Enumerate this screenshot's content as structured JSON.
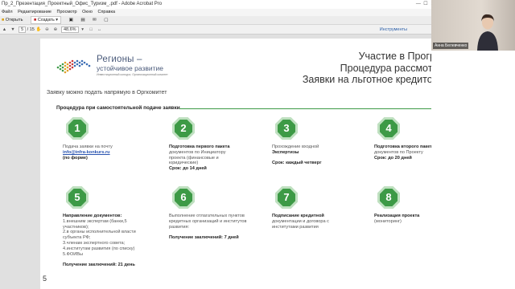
{
  "window": {
    "title": "Пр_2_Презентация_Проектный_Офис_Туризм_.pdf - Adobe Acrobat Pro",
    "controls": [
      "—",
      "☐",
      "✕"
    ]
  },
  "menubar": [
    "Файл",
    "Редактирование",
    "Просмотр",
    "Окно",
    "Справка"
  ],
  "toolbar": {
    "open_label": "Открыть",
    "create_label": "Создать",
    "create_arrow": "▾"
  },
  "navbar": {
    "page_current": "5",
    "page_total": "/ 15",
    "zoom": "48,6%",
    "tools_label": "Инструменты"
  },
  "video": {
    "participant_name": "Анна Белевченко"
  },
  "slide": {
    "logo_title": "Регионы –",
    "logo_subtitle": "устойчивое развитие",
    "logo_caption": "Инвестиционный конкурс; Организационный комитет",
    "headline": [
      "Участие в Программе",
      "Процедура рассмотрения",
      "Заявки на льготное кредитование"
    ],
    "apply_note": "Заявку можно подать напрямую в Оргкомитет",
    "procedure_title": "Процедура при самостоятельной подаче заявки",
    "page_number": "5",
    "steps": [
      {
        "num": "1",
        "lines": [
          {
            "t": "Подача заявки на почту",
            "s": "n"
          },
          {
            "t": "info@infra-konkurs.ru",
            "s": "link"
          },
          {
            "t": "(по форме)",
            "s": "b"
          }
        ]
      },
      {
        "num": "2",
        "lines": [
          {
            "t": "Подготовка первого пакета",
            "s": "b"
          },
          {
            "t": "документов по Инициатору",
            "s": "n"
          },
          {
            "t": "проекта (финансовые и",
            "s": "n"
          },
          {
            "t": "юридические)",
            "s": "n"
          },
          {
            "t": "Срок: до 14 дней",
            "s": "b"
          }
        ]
      },
      {
        "num": "3",
        "lines": [
          {
            "t": "Прохождение входной",
            "s": "mixed1"
          },
          {
            "t": "Экспертизы",
            "s": "b"
          },
          {
            "t": "",
            "s": "n"
          },
          {
            "t": "Срок: каждый четверг",
            "s": "b"
          }
        ]
      },
      {
        "num": "4",
        "lines": [
          {
            "t": "Подготовка второго пакета",
            "s": "b"
          },
          {
            "t": "документов по Проекту",
            "s": "n"
          },
          {
            "t": "Срок: до 20 дней",
            "s": "b"
          }
        ]
      },
      {
        "num": "5",
        "lines": [
          {
            "t": "Направление документов:",
            "s": "b"
          },
          {
            "t": "1.внешним экспертам (банки,5",
            "s": "n"
          },
          {
            "t": "участников);",
            "s": "n"
          },
          {
            "t": "2.в органы исполнительной власти",
            "s": "n"
          },
          {
            "t": "субъекта РФ;",
            "s": "n"
          },
          {
            "t": "3.членам экспертного совета;",
            "s": "n"
          },
          {
            "t": "4.институтам развития (по списку)",
            "s": "n"
          },
          {
            "t": "5.ФОИВы",
            "s": "n"
          },
          {
            "t": "",
            "s": "n"
          },
          {
            "t": "Получение заключений: 21 день",
            "s": "b"
          }
        ]
      },
      {
        "num": "6",
        "lines": [
          {
            "t": "Выполнение отлагательных пунктов",
            "s": "n"
          },
          {
            "t": "кредитных организаций и институтов",
            "s": "n"
          },
          {
            "t": "развития:",
            "s": "n"
          },
          {
            "t": "",
            "s": "n"
          },
          {
            "t": "Получение заключений: 7 дней",
            "s": "b"
          }
        ]
      },
      {
        "num": "7",
        "lines": [
          {
            "t": "Подписание кредитной",
            "s": "b"
          },
          {
            "t": "документации и договора с",
            "s": "mixed2"
          },
          {
            "t": "институтами развития",
            "s": "n"
          }
        ]
      },
      {
        "num": "8",
        "lines": [
          {
            "t": "Реализация проекта",
            "s": "b"
          },
          {
            "t": "(мониторинг)",
            "s": "n"
          }
        ]
      }
    ]
  }
}
